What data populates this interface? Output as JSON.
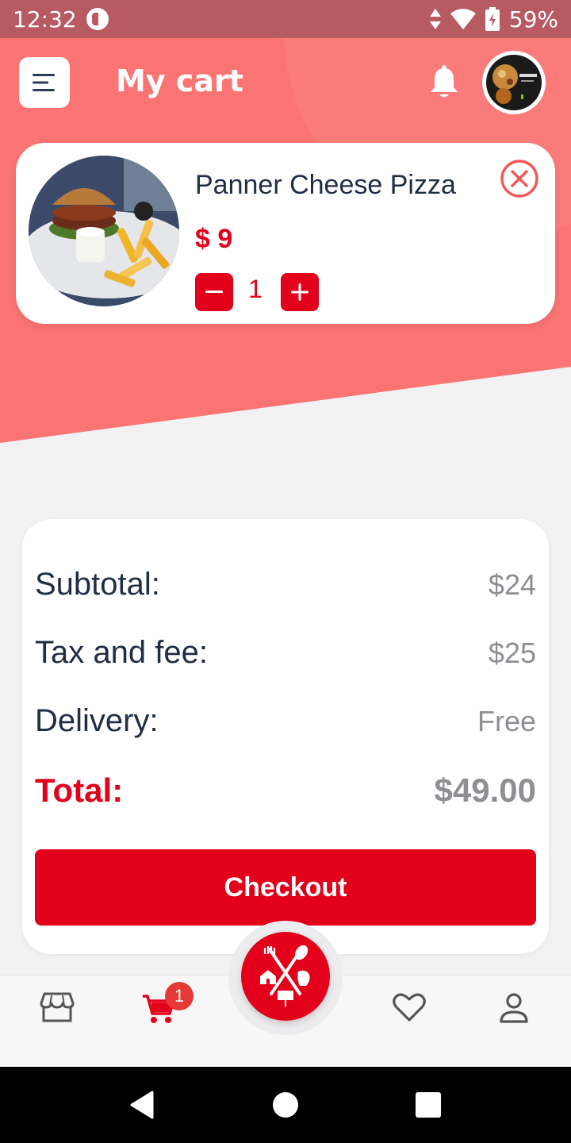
{
  "status_bar": {
    "time": "12:32",
    "battery": "59%"
  },
  "header": {
    "title": "My cart"
  },
  "cart_item": {
    "name": "Panner Cheese Pizza",
    "price": "$ 9",
    "quantity": "1"
  },
  "summary": {
    "subtotal_label": "Subtotal:",
    "subtotal_value": "$24",
    "tax_label": "Tax and fee:",
    "tax_value": "$25",
    "delivery_label": "Delivery:",
    "delivery_value": "Free",
    "total_label": "Total:",
    "total_value": "$49.00",
    "checkout_label": "Checkout"
  },
  "bottom_nav": {
    "items": [
      "store-icon",
      "cart-icon",
      "heart-icon",
      "profile-icon"
    ],
    "cart_badge": "1"
  },
  "colors": {
    "accent": "#e2001a",
    "header_band": "#fa7474",
    "background": "#f2f2f3"
  }
}
